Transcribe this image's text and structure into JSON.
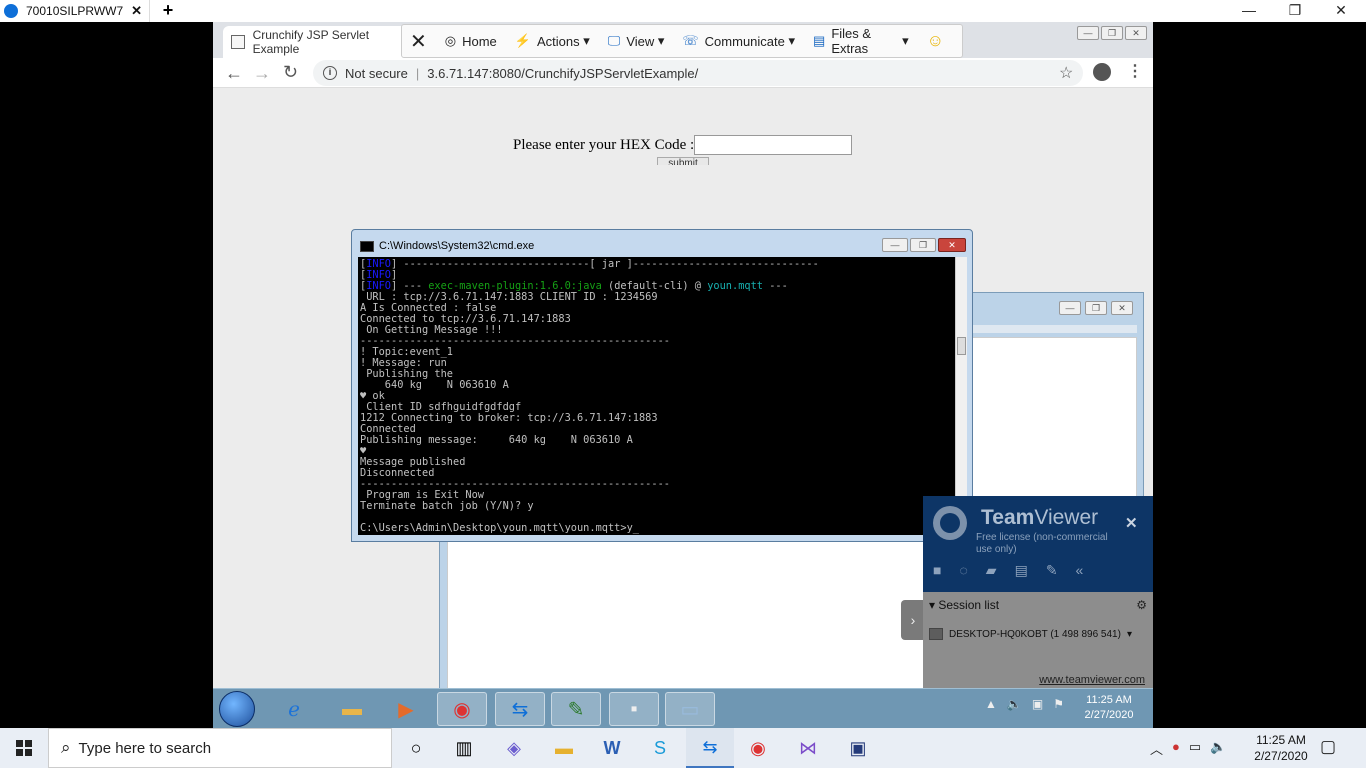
{
  "outer": {
    "tab_label": "70010SILPRWW7",
    "tab_close": "✕",
    "new_tab": "+",
    "minimize": "—",
    "restore": "❐",
    "close": "✕"
  },
  "chrome": {
    "tab_title": "Crunchify JSP Servlet Example",
    "address_prefix": "Not secure",
    "address_url": "3.6.71.147:8080/CrunchifyJSPServletExample/"
  },
  "teamviewer_toolbar": {
    "items": [
      "Home",
      "Actions",
      "View",
      "Communicate",
      "Files & Extras"
    ]
  },
  "page": {
    "hex_label": "Please enter your HEX Code :",
    "submit_label": "submit"
  },
  "cmd": {
    "title": "C:\\Windows\\System32\\cmd.exe",
    "lines": [
      {
        "info": "INFO",
        "text": " ------------------------------[ jar ]------------------------------"
      },
      {
        "info": "INFO",
        "text": ""
      },
      {
        "info": "INFO",
        "text": " --- ",
        "green": "exec-maven-plugin:1.6.0:java",
        "rest": " (default-cli) @ ",
        "cyan": "youn.mqtt",
        "tail": " ---"
      },
      {
        "text": " URL : tcp://3.6.71.147:1883 CLIENT ID : 1234569"
      },
      {
        "text": "A Is Connected : false"
      },
      {
        "text": "Connected to tcp://3.6.71.147:1883"
      },
      {
        "text": " On Getting Message !!!"
      },
      {
        "text": "--------------------------------------------------"
      },
      {
        "text": "! Topic:event_1"
      },
      {
        "text": "! Message: run"
      },
      {
        "text": " Publishing the"
      },
      {
        "text": "    640 kg    N 063610 A"
      },
      {
        "text": "♥ ok"
      },
      {
        "text": " Client ID sdfhguidfgdfdgf"
      },
      {
        "text": "1212 Connecting to broker: tcp://3.6.71.147:1883"
      },
      {
        "text": "Connected"
      },
      {
        "text": "Publishing message:     640 kg    N 063610 A"
      },
      {
        "text": "♥"
      },
      {
        "text": "Message published"
      },
      {
        "text": "Disconnected"
      },
      {
        "text": "--------------------------------------------------"
      },
      {
        "text": " Program is Exit Now"
      },
      {
        "text": "Terminate batch job (Y/N)? y"
      },
      {
        "text": ""
      },
      {
        "text": "C:\\Users\\Admin\\Desktop\\youn.mqtt\\youn.mqtt>y_"
      }
    ]
  },
  "teamviewer_panel": {
    "brand_bold": "Team",
    "brand_rest": "Viewer",
    "license": "Free license (non-commercial use only)",
    "close": "✕",
    "session_title": "Session list",
    "session_item": "DESKTOP-HQ0KOBT (1 498 896 541)",
    "website": "www.teamviewer.com"
  },
  "remote_taskbar": {
    "time": "11:25 AM",
    "date": "2/27/2020"
  },
  "taskbar": {
    "search_placeholder": "Type here to search",
    "time": "11:25 AM",
    "date": "2/27/2020"
  }
}
